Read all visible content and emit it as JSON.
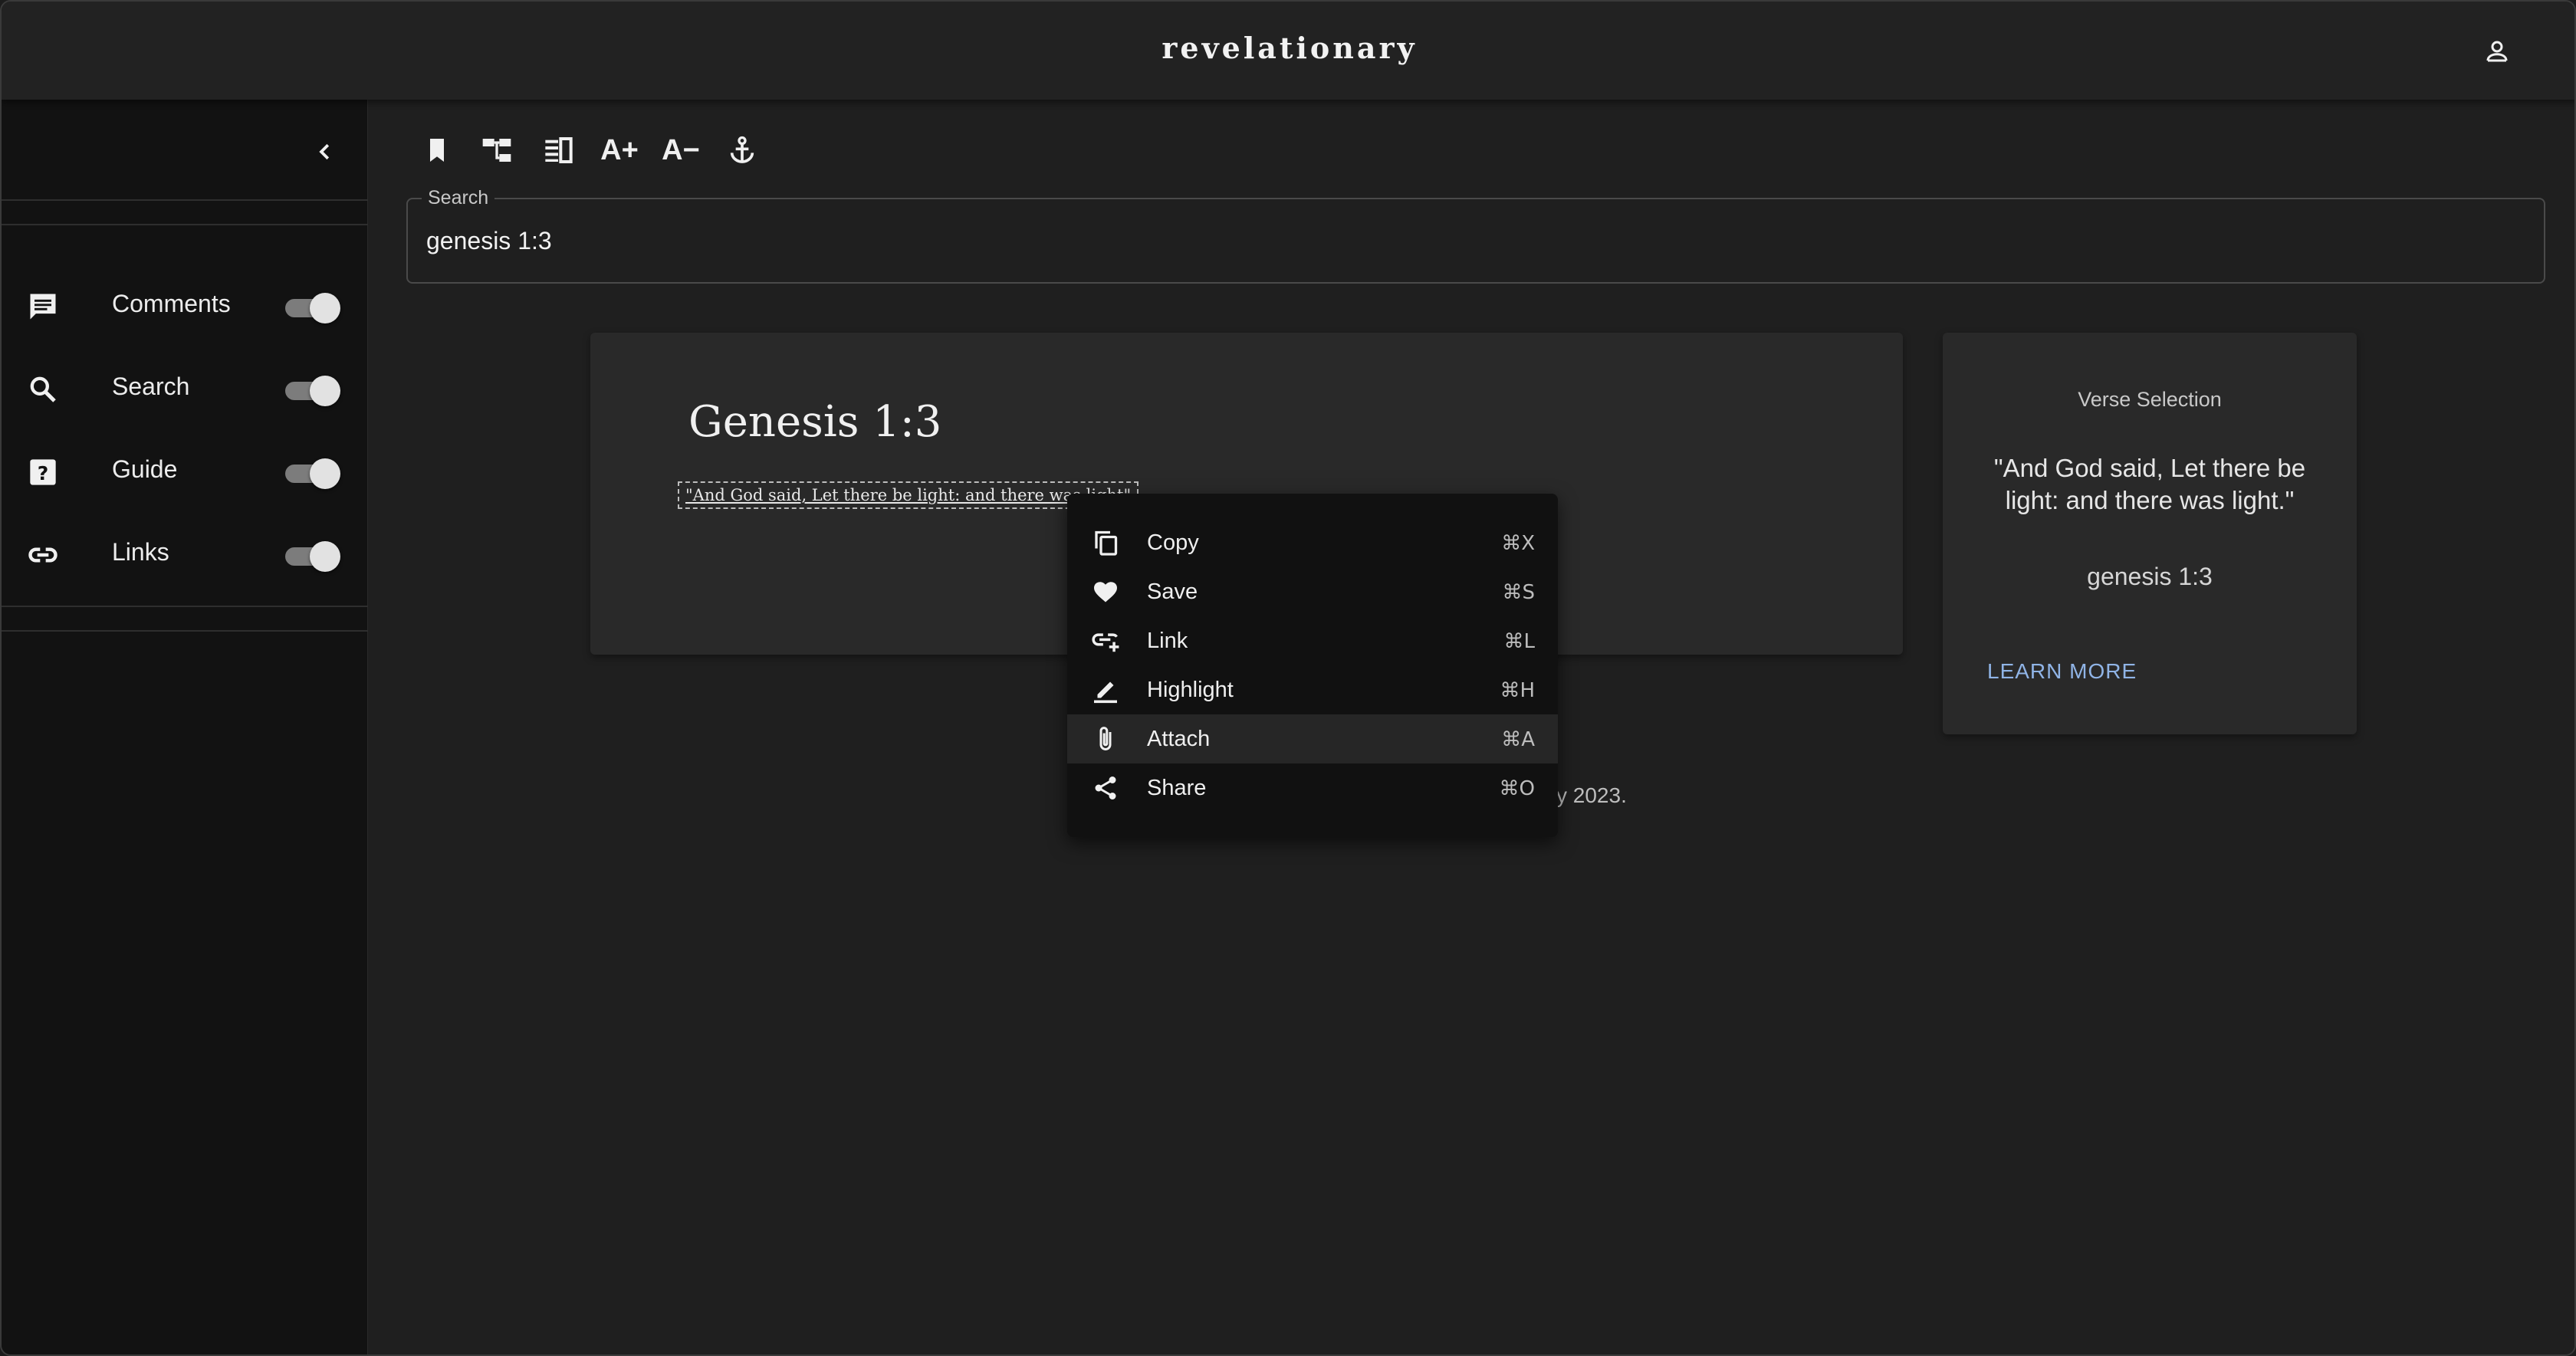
{
  "app": {
    "title": "revelationary"
  },
  "header": {
    "account_icon": "account-icon"
  },
  "sidebar": {
    "collapse_icon": "chevron-left-icon",
    "items": [
      {
        "label": "Comments",
        "icon": "comment-icon",
        "enabled": true
      },
      {
        "label": "Search",
        "icon": "search-icon",
        "enabled": true
      },
      {
        "label": "Guide",
        "icon": "help-icon",
        "enabled": true
      },
      {
        "label": "Links",
        "icon": "link-icon",
        "enabled": true
      }
    ]
  },
  "toolbar": {
    "buttons": [
      {
        "icon": "bookmark-icon"
      },
      {
        "icon": "tree-icon"
      },
      {
        "icon": "columns-icon"
      },
      {
        "icon": "font-increase-icon",
        "text": "A+"
      },
      {
        "icon": "font-decrease-icon",
        "text": "A−"
      },
      {
        "icon": "anchor-icon"
      }
    ]
  },
  "search": {
    "label": "Search",
    "value": "genesis 1:3"
  },
  "verse": {
    "title": "Genesis 1:3",
    "text": "\"And God said, Let there be light: and there was light\""
  },
  "footer": {
    "text_visible": "y 2023."
  },
  "verse_selection": {
    "heading": "Verse Selection",
    "quote": "\"And God said, Let there be light: and there was light.\"",
    "reference": "genesis 1:3",
    "action": "LEARN MORE"
  },
  "context_menu": {
    "items": [
      {
        "label": "Copy",
        "shortcut": "⌘X",
        "icon": "copy-icon"
      },
      {
        "label": "Save",
        "shortcut": "⌘S",
        "icon": "heart-icon"
      },
      {
        "label": "Link",
        "shortcut": "⌘L",
        "icon": "add-link-icon"
      },
      {
        "label": "Highlight",
        "shortcut": "⌘H",
        "icon": "pencil-icon"
      },
      {
        "label": "Attach",
        "shortcut": "⌘A",
        "icon": "paperclip-icon",
        "active": true
      },
      {
        "label": "Share",
        "shortcut": "⌘O",
        "icon": "share-icon"
      }
    ]
  },
  "colors": {
    "background": "#1f1f1f",
    "sidebar": "#121212",
    "card": "#292929",
    "menu": "#111111",
    "accent_link": "#90b4e6"
  }
}
